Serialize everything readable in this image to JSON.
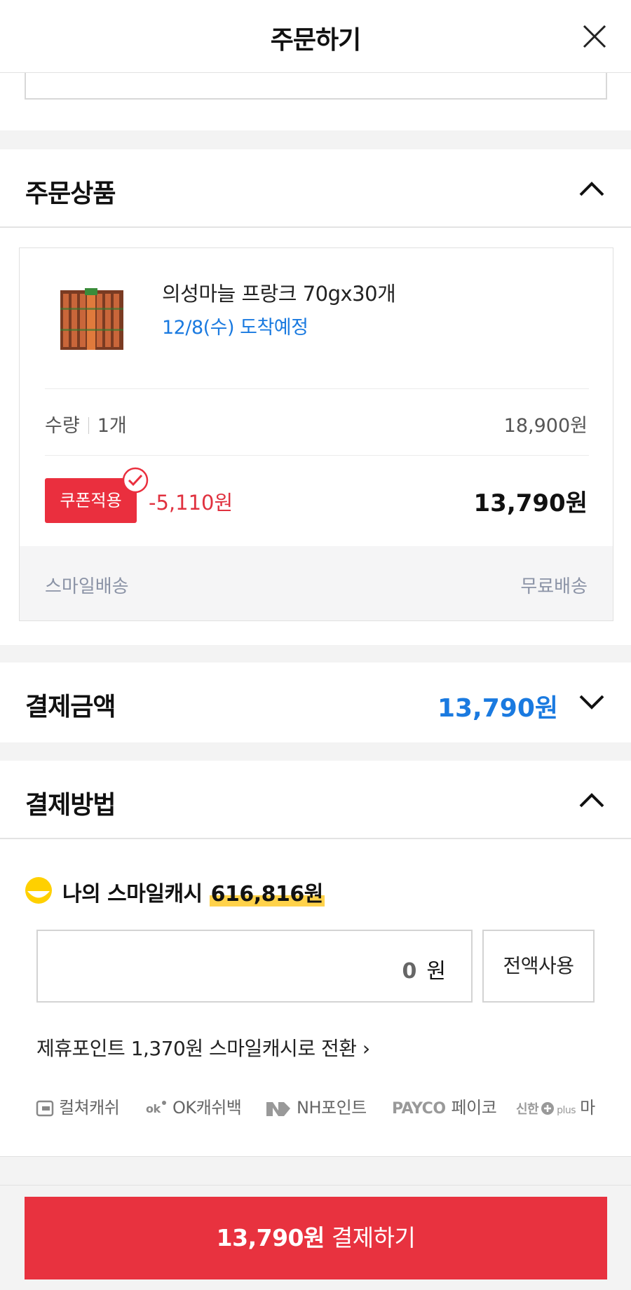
{
  "header": {
    "title": "주문하기"
  },
  "order_items": {
    "section_title": "주문상품",
    "product": {
      "name": "의성마늘 프랑크 70gx30개",
      "arrival": "12/8(수) 도착예정",
      "qty_label": "수량",
      "qty_value": "1개",
      "original_price": "18,900원",
      "coupon_label": "쿠폰적용",
      "discount": "-5,110원",
      "final_price": "13,790원",
      "shipping_type": "스마일배송",
      "shipping_fee": "무료배송"
    }
  },
  "payment_amount": {
    "section_title": "결제금액",
    "amount": "13,790원"
  },
  "payment_method": {
    "section_title": "결제방법",
    "smile_cash_label": "나의 스마일캐시",
    "smile_cash_balance": "616,816원",
    "input_value": "0",
    "input_unit": "원",
    "full_use_label": "전액사용",
    "convert_text": "제휴포인트 1,370원 스마일캐시로 전환",
    "convert_arrow": "›",
    "points": [
      "컬쳐캐쉬",
      "OK캐쉬백",
      "NH포인트",
      "페이코",
      "마이"
    ],
    "point_logos": {
      "payco": "PAYCO",
      "shinhan": "신한",
      "shinhan_plus": "plus"
    }
  },
  "bottom_bar": {
    "amount": "13,790원",
    "pay_label": "결제하기"
  },
  "colors": {
    "accent_red": "#e8323f",
    "accent_blue": "#1a7ae0",
    "highlight_yellow": "#ffd24a"
  }
}
